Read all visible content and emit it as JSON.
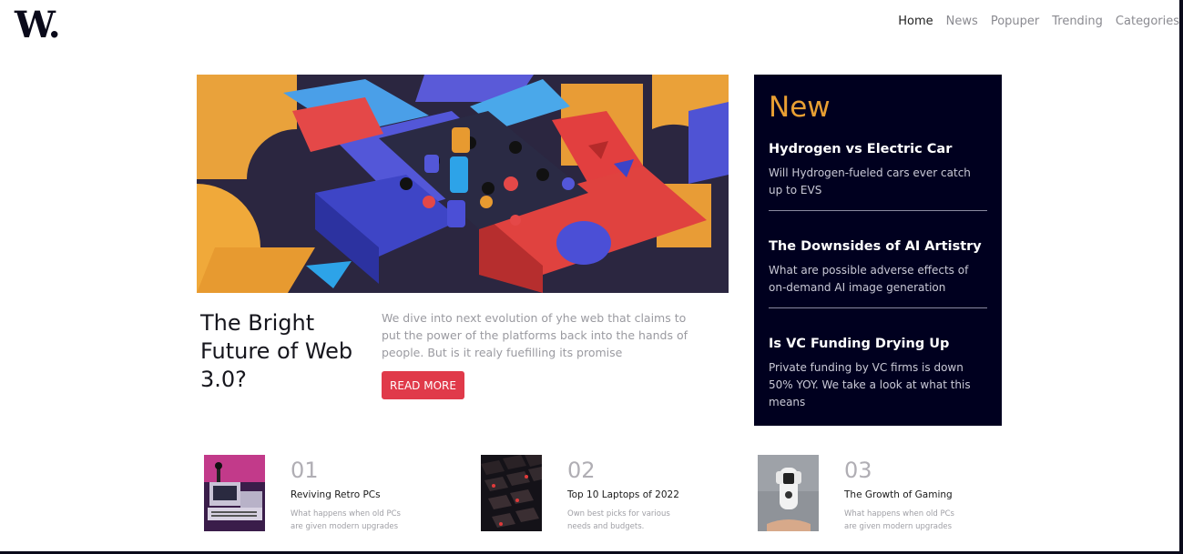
{
  "logo": "W.",
  "nav": {
    "items": [
      "Home",
      "News",
      "Popuper",
      "Trending",
      "Categories"
    ],
    "active": "Home"
  },
  "hero": {
    "title": "The Bright Future of Web 3.0?",
    "description": "We dive into next evolution of yhe web that claims to put the power of the platforms back into the hands of people. But is it realy fuefilling its promise",
    "button_label": "READ MORE"
  },
  "new_panel": {
    "heading": "New",
    "items": [
      {
        "title": "Hydrogen vs Electric Car",
        "desc": "Will Hydrogen-fueled cars ever catch up to EVS"
      },
      {
        "title": "The Downsides of AI Artistry",
        "desc": "What are possible adverse effects of on-demand AI image generation"
      },
      {
        "title": "Is VC Funding Drying Up",
        "desc": "Private funding by VC firms is down 50% YOY. We take a look at what this means"
      }
    ]
  },
  "cards": [
    {
      "num": "01",
      "title": "Reviving Retro PCs",
      "desc": "What happens when old PCs are given modern upgrades"
    },
    {
      "num": "02",
      "title": "Top 10 Laptops of 2022",
      "desc": "Own best picks for various needs and budgets."
    },
    {
      "num": "03",
      "title": "The Growth of Gaming",
      "desc": "What happens when old PCs are given modern upgrades"
    }
  ],
  "colors": {
    "accent": "#e89f33",
    "panel_bg": "#00001f",
    "button": "#e03a4a"
  }
}
